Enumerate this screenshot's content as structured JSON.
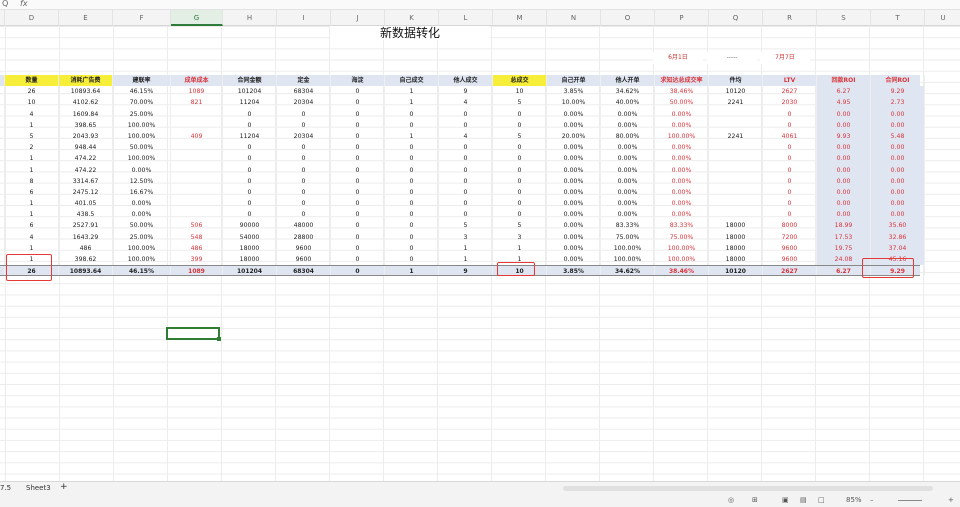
{
  "formula_bar": {
    "name_box": "Q",
    "fx": "fx"
  },
  "columns": [
    "D",
    "E",
    "F",
    "G",
    "H",
    "I",
    "J",
    "K",
    "L",
    "M",
    "N",
    "O",
    "P",
    "Q",
    "R",
    "S",
    "T",
    "U"
  ],
  "selected_column": "G",
  "sheet_title": "新数据转化",
  "dates": {
    "start": "6月1日",
    "sep": "-----",
    "end": "7月7日"
  },
  "headers": [
    "数量",
    "消耗广告费",
    "建联率",
    "成单成本",
    "合同金额",
    "定金",
    "海淀",
    "自己成交",
    "他人成交",
    "总成交",
    "自己开单",
    "他人开单",
    "求知达总成交率",
    "件均",
    "LTV",
    "回款ROI",
    "合同ROI"
  ],
  "rows": [
    [
      "26",
      "10893.64",
      "46.15%",
      "1089",
      "101204",
      "68304",
      "0",
      "1",
      "9",
      "10",
      "3.85%",
      "34.62%",
      "38.46%",
      "10120",
      "2627",
      "6.27",
      "9.29"
    ],
    [
      "10",
      "4102.62",
      "70.00%",
      "821",
      "11204",
      "20304",
      "0",
      "1",
      "4",
      "5",
      "10.00%",
      "40.00%",
      "50.00%",
      "2241",
      "2030",
      "4.95",
      "2.73"
    ],
    [
      "4",
      "1609.84",
      "25.00%",
      "",
      "0",
      "0",
      "0",
      "0",
      "0",
      "0",
      "0.00%",
      "0.00%",
      "0.00%",
      "",
      "0",
      "0.00",
      "0.00"
    ],
    [
      "1",
      "398.65",
      "100.00%",
      "",
      "0",
      "0",
      "0",
      "0",
      "0",
      "0",
      "0.00%",
      "0.00%",
      "0.00%",
      "",
      "0",
      "0.00",
      "0.00"
    ],
    [
      "5",
      "2043.93",
      "100.00%",
      "409",
      "11204",
      "20304",
      "0",
      "1",
      "4",
      "5",
      "20.00%",
      "80.00%",
      "100.00%",
      "2241",
      "4061",
      "9.93",
      "5.48"
    ],
    [
      "2",
      "948.44",
      "50.00%",
      "",
      "0",
      "0",
      "0",
      "0",
      "0",
      "0",
      "0.00%",
      "0.00%",
      "0.00%",
      "",
      "0",
      "0.00",
      "0.00"
    ],
    [
      "1",
      "474.22",
      "100.00%",
      "",
      "0",
      "0",
      "0",
      "0",
      "0",
      "0",
      "0.00%",
      "0.00%",
      "0.00%",
      "",
      "0",
      "0.00",
      "0.00"
    ],
    [
      "1",
      "474.22",
      "0.00%",
      "",
      "0",
      "0",
      "0",
      "0",
      "0",
      "0",
      "0.00%",
      "0.00%",
      "0.00%",
      "",
      "0",
      "0.00",
      "0.00"
    ],
    [
      "8",
      "3314.67",
      "12.50%",
      "",
      "0",
      "0",
      "0",
      "0",
      "0",
      "0",
      "0.00%",
      "0.00%",
      "0.00%",
      "",
      "0",
      "0.00",
      "0.00"
    ],
    [
      "6",
      "2475.12",
      "16.67%",
      "",
      "0",
      "0",
      "0",
      "0",
      "0",
      "0",
      "0.00%",
      "0.00%",
      "0.00%",
      "",
      "0",
      "0.00",
      "0.00"
    ],
    [
      "1",
      "401.05",
      "0.00%",
      "",
      "0",
      "0",
      "0",
      "0",
      "0",
      "0",
      "0.00%",
      "0.00%",
      "0.00%",
      "",
      "0",
      "0.00",
      "0.00"
    ],
    [
      "1",
      "438.5",
      "0.00%",
      "",
      "0",
      "0",
      "0",
      "0",
      "0",
      "0",
      "0.00%",
      "0.00%",
      "0.00%",
      "",
      "0",
      "0.00",
      "0.00"
    ],
    [
      "6",
      "2527.91",
      "50.00%",
      "506",
      "90000",
      "48000",
      "0",
      "0",
      "5",
      "5",
      "0.00%",
      "83.33%",
      "83.33%",
      "18000",
      "8000",
      "18.99",
      "35.60"
    ],
    [
      "4",
      "1643.29",
      "25.00%",
      "548",
      "54000",
      "28800",
      "0",
      "0",
      "3",
      "3",
      "0.00%",
      "75.00%",
      "75.00%",
      "18000",
      "7200",
      "17.53",
      "32.86"
    ],
    [
      "1",
      "486",
      "100.00%",
      "486",
      "18000",
      "9600",
      "0",
      "0",
      "1",
      "1",
      "0.00%",
      "100.00%",
      "100.00%",
      "18000",
      "9600",
      "19.75",
      "37.04"
    ],
    [
      "1",
      "398.62",
      "100.00%",
      "399",
      "18000",
      "9600",
      "0",
      "0",
      "1",
      "1",
      "0.00%",
      "100.00%",
      "100.00%",
      "18000",
      "9600",
      "24.08",
      "45.16"
    ]
  ],
  "totals": [
    "26",
    "10893.64",
    "46.15%",
    "1089",
    "101204",
    "68304",
    "0",
    "1",
    "9",
    "10",
    "3.85%",
    "34.62%",
    "38.46%",
    "10120",
    "2627",
    "6.27",
    "9.29"
  ],
  "tabs": {
    "prev": "7.5",
    "sheet": "Sheet3",
    "add": "+"
  },
  "status": {
    "zoom": "85%",
    "minus": "–",
    "plus": "+"
  }
}
